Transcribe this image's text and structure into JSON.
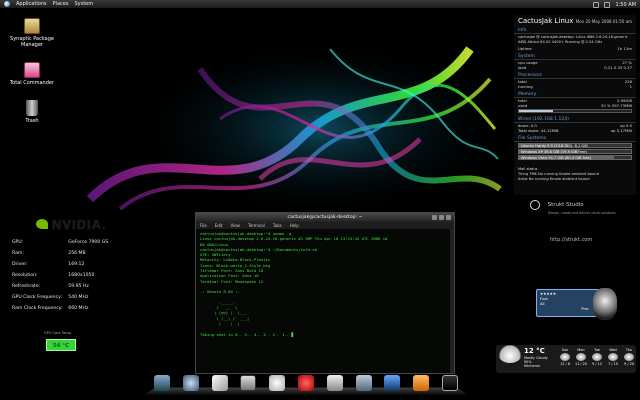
{
  "panel": {
    "menus": [
      "Applications",
      "Places",
      "System"
    ],
    "clock": "1:50 AM"
  },
  "desktop": {
    "icons": [
      {
        "label": "Synaptic Package Manager",
        "icon": "package-icon"
      },
      {
        "label": "Total Commander",
        "icon": "commander-icon"
      },
      {
        "label": "Trash",
        "icon": "trash-icon"
      }
    ]
  },
  "gpu": {
    "brand": "NVIDIA.",
    "rows": [
      {
        "label": "GPU:",
        "value": "GeForce 7900 GS"
      },
      {
        "label": "Ram:",
        "value": "256 MB"
      },
      {
        "label": "Driver:",
        "value": "169.12"
      },
      {
        "label": "Resolution:",
        "value": "1680x1050"
      },
      {
        "label": "Refreshrate:",
        "value": "59.95 Hz"
      },
      {
        "label": "GPU Clock Frequency:",
        "value": "540 MHz"
      },
      {
        "label": "Ram Clock Frequency:",
        "value": "660 MHz"
      }
    ],
    "temp_label": "GPU Core Temp",
    "temp": "54 °C",
    "temp_color": "#3bd13b"
  },
  "sysmon": {
    "title": "CactusJak Linux",
    "date": "Mon 20 May 2008 01:50 am",
    "sections": {
      "info": "Info",
      "processors": "Processors",
      "memory": "Memory",
      "network": "Wired (192.168.1.124)",
      "filesystem": "File Systems"
    },
    "kernel": "cactusjak @ cactusjak-desktop: Linux i686 2.6.24-16-generic AMD Athlon 64 X2 4400+ Running @ 2.54 GHz",
    "uptime_label": "Uptime",
    "uptime": "1h 11m",
    "cpu_label": "cpu usage",
    "cpu": "27 %",
    "load_label": "load",
    "load": "0.21 0.33 0.37",
    "total_label": "total",
    "total": "226",
    "running_label": "running",
    "running": "1",
    "mem_total_label": "total",
    "mem_total": "2.99GiB",
    "mem_used_label": "used",
    "mem_used": "30 % 397.73MiB",
    "mem_pct": 30,
    "down_label": "down: 0.0",
    "down": "up 0.0",
    "total_down_label": "Total down: 44.12MiB",
    "total_down": "up 5.17MiB",
    "fs": [
      {
        "label": "Ubuntu Hardy 9.5 (13.8 GiB): 6.1 GiB",
        "pct": 44
      },
      {
        "label": "Windows XP 36.8 GiB (19.9 GiB free)",
        "pct": 54
      },
      {
        "label": "Windows Vista 94.7 GiB (80.4 GiB free)",
        "pct": 85
      }
    ]
  },
  "mail": {
    "title": "Mail status",
    "lines": [
      "Tiring TMK No running Kmale ambient bound",
      "Artist No running Kmale ambient bound"
    ]
  },
  "strukt": {
    "name": "Strukt Studio",
    "sub": "Design, create and deliver visual solutions",
    "url": "http://strukt.com"
  },
  "music": {
    "rating": "★★★★★",
    "rows": [
      "Fuzz",
      "All",
      "Zuzu"
    ],
    "status": "Pmc"
  },
  "weather": {
    "temp": "12 °C",
    "condition": "Mostly Cloudy 90%",
    "place": "Kitchener",
    "days": [
      {
        "name": "Sun",
        "range": "12 / 6"
      },
      {
        "name": "Mon",
        "range": "11 / 20"
      },
      {
        "name": "Tue",
        "range": "9 / 12"
      },
      {
        "name": "Wed",
        "range": "7 / 15"
      },
      {
        "name": "Thu",
        "range": "9 / 20"
      }
    ]
  },
  "terminal": {
    "title": "cactusjak@cactusjak-desktop: ~",
    "menus": [
      "File",
      "Edit",
      "View",
      "Terminal",
      "Tabs",
      "Help"
    ],
    "output": "cactusjak@cactusjak-desktop:~$ uname -a\nLinux cactusjak-desktop 2.6.24-16-generic #1 SMP Thu Apr 10 13:23:42 UTC 2008 i6\n86 GNU/Linux\ncactusjak@cactusjak-desktop:~$ ~/Documents/info.sh\nGTK: SWTriety\nMetacity: LiNota-Black-Plastic\nIcons: Black-white_2-Style_big\nTitlebar Font: Sans Bold 10\nApplication Font: Sans 10\nTerminal Font: Monospace 12\n\n.: Ubuntu 8.04 :.\n\n        ._____.\n       /   __  \\\n      | (oo) |  |___\n       \\ /__\\ /  ___|\n        |    |  |\n\nTaking shot in 6.. 5.. 4.. 3.. 2.. 1.. ▊"
  },
  "dock": {
    "items": [
      "finder-icon",
      "network-icon",
      "vim-icon",
      "x-icon",
      "star-icon",
      "media-icon",
      "drive-icon",
      "mail-icon",
      "music-icon",
      "vlc-icon",
      "monitor-icon"
    ]
  }
}
